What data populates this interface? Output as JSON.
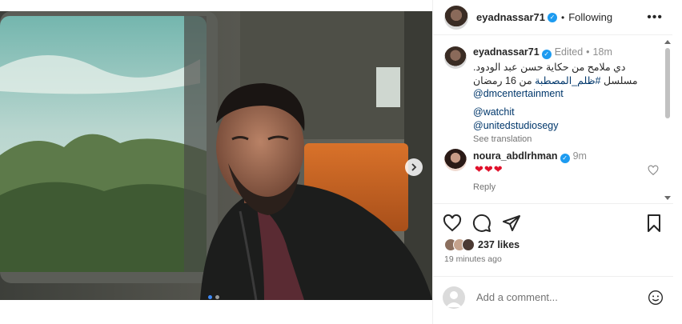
{
  "post": {
    "username": "eyadnassar71",
    "follow_status": "Following",
    "separator": "•",
    "more_icon": "ellipsis-icon",
    "caption": {
      "edited_label": "Edited",
      "time": "18m",
      "line1": "دي ملامح من حكاية حسن عبد الودود.",
      "line2_prefix": "مسلسل ",
      "line2_tag": "#ظلم_المصطبة",
      "line2_suffix": " من 16 رمضان",
      "mention1": "@dmcentertainment",
      "mention2": "@watchit",
      "mention3": "@unitedstudiosegy",
      "see_translation": "See translation"
    },
    "comment": {
      "username": "noura_abdlrhman",
      "time": "9m",
      "text": "❤❤❤",
      "reply_label": "Reply"
    },
    "likes": "237 likes",
    "posted_ago": "19 minutes ago",
    "add_comment_placeholder": "Add a comment...",
    "carousel": {
      "slides": 2,
      "current": 1
    },
    "colors": {
      "verified": "#1d9bf0",
      "tag": "#00376b",
      "heart": "#e0112b",
      "dot_active": "#3d8af7"
    }
  }
}
